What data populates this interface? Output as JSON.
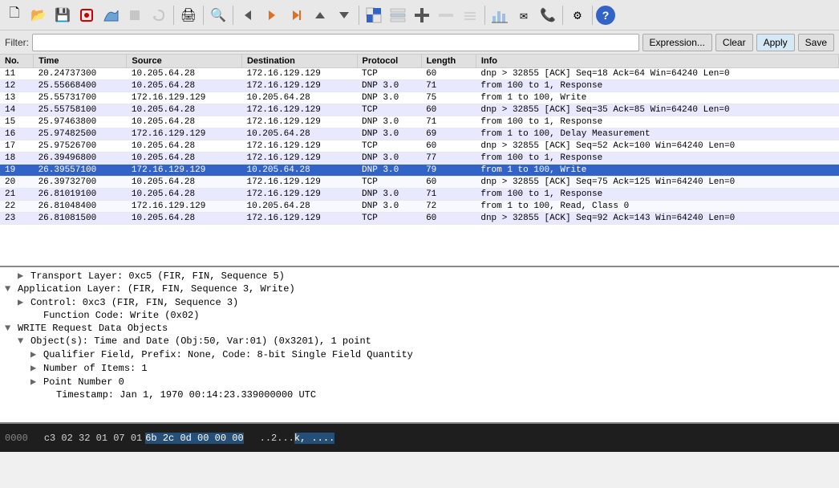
{
  "toolbar": {
    "icons": [
      {
        "name": "new-capture-icon",
        "symbol": "🗋",
        "disabled": false
      },
      {
        "name": "open-icon",
        "symbol": "📂",
        "disabled": false
      },
      {
        "name": "save-icon",
        "symbol": "💾",
        "disabled": false
      },
      {
        "name": "capture-options-icon",
        "symbol": "🔴",
        "disabled": false
      },
      {
        "name": "capture-start-icon",
        "symbol": "🐟",
        "disabled": false
      },
      {
        "name": "capture-stop-icon",
        "symbol": "🔲",
        "disabled": false
      },
      {
        "name": "capture-restart-icon",
        "symbol": "⟳",
        "disabled": false
      },
      {
        "name": "print-icon",
        "symbol": "🖨",
        "disabled": false
      },
      {
        "name": "find-icon",
        "symbol": "🔍",
        "disabled": false
      },
      {
        "name": "go-back-icon",
        "symbol": "◀",
        "disabled": false
      },
      {
        "name": "go-forward-icon",
        "symbol": "▶",
        "disabled": false
      },
      {
        "name": "go-to-packet-icon",
        "symbol": "↺",
        "disabled": false
      },
      {
        "name": "go-first-icon",
        "symbol": "⬆",
        "disabled": false
      },
      {
        "name": "go-last-icon",
        "symbol": "⬇",
        "disabled": false
      }
    ]
  },
  "filterbar": {
    "label": "Filter:",
    "placeholder": "",
    "expression_btn": "Expression...",
    "clear_btn": "Clear",
    "apply_btn": "Apply",
    "save_btn": "Save"
  },
  "columns": {
    "no": "No.",
    "time": "Time",
    "source": "Source",
    "destination": "Destination",
    "protocol": "Protocol",
    "length": "Length",
    "info": "Info"
  },
  "packets": [
    {
      "no": "11",
      "time": "20.24737300",
      "source": "10.205.64.28",
      "dest": "172.16.129.129",
      "proto": "TCP",
      "len": "60",
      "info": "dnp > 32855 [ACK] Seq=18 Ack=64 Win=64240 Len=0",
      "class": ""
    },
    {
      "no": "12",
      "time": "25.55668400",
      "source": "10.205.64.28",
      "dest": "172.16.129.129",
      "proto": "DNP 3.0",
      "len": "71",
      "info": "from 100 to 1, Response",
      "class": "dnp"
    },
    {
      "no": "13",
      "time": "25.55731700",
      "source": "172.16.129.129",
      "dest": "10.205.64.28",
      "proto": "DNP 3.0",
      "len": "75",
      "info": "from 1 to 100, Write",
      "class": ""
    },
    {
      "no": "14",
      "time": "25.55758100",
      "source": "10.205.64.28",
      "dest": "172.16.129.129",
      "proto": "TCP",
      "len": "60",
      "info": "dnp > 32855 [ACK] Seq=35 Ack=85 Win=64240 Len=0",
      "class": "dnp"
    },
    {
      "no": "15",
      "time": "25.97463800",
      "source": "10.205.64.28",
      "dest": "172.16.129.129",
      "proto": "DNP 3.0",
      "len": "71",
      "info": "from 100 to 1, Response",
      "class": ""
    },
    {
      "no": "16",
      "time": "25.97482500",
      "source": "172.16.129.129",
      "dest": "10.205.64.28",
      "proto": "DNP 3.0",
      "len": "69",
      "info": "from 1 to 100, Delay Measurement",
      "class": "dnp"
    },
    {
      "no": "17",
      "time": "25.97526700",
      "source": "10.205.64.28",
      "dest": "172.16.129.129",
      "proto": "TCP",
      "len": "60",
      "info": "dnp > 32855 [ACK] Seq=52 Ack=100 Win=64240 Len=0",
      "class": ""
    },
    {
      "no": "18",
      "time": "26.39496800",
      "source": "10.205.64.28",
      "dest": "172.16.129.129",
      "proto": "DNP 3.0",
      "len": "77",
      "info": "from 100 to 1, Response",
      "class": "dnp"
    },
    {
      "no": "19",
      "time": "26.39557100",
      "source": "172.16.129.129",
      "dest": "10.205.64.28",
      "proto": "DNP 3.0",
      "len": "79",
      "info": "from 1 to 100, Write",
      "class": "selected"
    },
    {
      "no": "20",
      "time": "26.39732700",
      "source": "10.205.64.28",
      "dest": "172.16.129.129",
      "proto": "TCP",
      "len": "60",
      "info": "dnp > 32855 [ACK] Seq=75 Ack=125 Win=64240 Len=0",
      "class": ""
    },
    {
      "no": "21",
      "time": "26.81019100",
      "source": "10.205.64.28",
      "dest": "172.16.129.129",
      "proto": "DNP 3.0",
      "len": "71",
      "info": "from 100 to 1, Response",
      "class": "dnp"
    },
    {
      "no": "22",
      "time": "26.81048400",
      "source": "172.16.129.129",
      "dest": "10.205.64.28",
      "proto": "DNP 3.0",
      "len": "72",
      "info": "from 1 to 100, Read, Class 0",
      "class": ""
    },
    {
      "no": "23",
      "time": "26.81081500",
      "source": "10.205.64.28",
      "dest": "172.16.129.129",
      "proto": "TCP",
      "len": "60",
      "info": "dnp > 32855 [ACK] Seq=92 Ack=143 Win=64240 Len=0",
      "class": "dnp"
    }
  ],
  "detail": {
    "lines": [
      {
        "indent": 1,
        "toggle": "▶",
        "text": "Transport Layer: 0xc5 (FIR, FIN, Sequence 5)",
        "expandable": true
      },
      {
        "indent": 0,
        "toggle": "▼",
        "text": "Application Layer: (FIR, FIN, Sequence 3, Write)",
        "expandable": true
      },
      {
        "indent": 1,
        "toggle": "▶",
        "text": "Control: 0xc3 (FIR, FIN, Sequence 3)",
        "expandable": true
      },
      {
        "indent": 2,
        "toggle": " ",
        "text": "Function Code: Write (0x02)",
        "expandable": false
      },
      {
        "indent": 0,
        "toggle": "▼",
        "text": "WRITE Request Data Objects",
        "expandable": true
      },
      {
        "indent": 1,
        "toggle": "▼",
        "text": "Object(s): Time and Date (Obj:50, Var:01) (0x3201), 1 point",
        "expandable": true
      },
      {
        "indent": 2,
        "toggle": "▶",
        "text": "Qualifier Field, Prefix: None, Code: 8-bit Single Field Quantity",
        "expandable": true
      },
      {
        "indent": 2,
        "toggle": "▶",
        "text": "Number of Items: 1",
        "expandable": true
      },
      {
        "indent": 2,
        "toggle": "▶",
        "text": "Point Number 0",
        "expandable": true
      },
      {
        "indent": 3,
        "toggle": " ",
        "text": "Timestamp: Jan  1, 1970 00:14:23.339000000 UTC",
        "expandable": false
      }
    ]
  },
  "hex": {
    "offset": "0000",
    "bytes_before": "c3 02 32 01 07 01",
    "bytes_selected": "6b 2c  0d 00 00 00",
    "ascii_before": "..2...",
    "ascii_selected": "k,  ...."
  }
}
